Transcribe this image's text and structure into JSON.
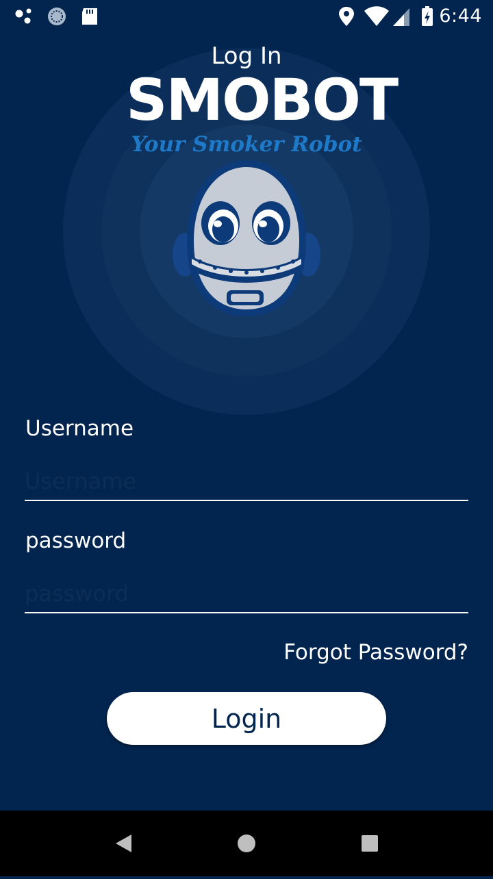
{
  "status_bar": {
    "time": "6:44",
    "icons_left": [
      "assistant-dots-icon",
      "sync-icon",
      "sd-card-icon"
    ],
    "icons_right": [
      "location-icon",
      "wifi-icon",
      "cell-signal-icon",
      "battery-charging-icon"
    ]
  },
  "page": {
    "title": "Log In",
    "logo_text": "SMOBOT",
    "tagline": "Your Smoker Robot"
  },
  "form": {
    "username_label": "Username",
    "username_placeholder": "Username",
    "username_value": "",
    "password_label": "password",
    "password_placeholder": "password",
    "password_value": "",
    "forgot_label": "Forgot Password?",
    "login_label": "Login"
  },
  "nav": {
    "back": "back-icon",
    "home": "home-icon",
    "recents": "recents-icon"
  },
  "colors": {
    "background": "#022550",
    "accent": "#1e7ac8",
    "robot_body": "#c5ccd6"
  }
}
